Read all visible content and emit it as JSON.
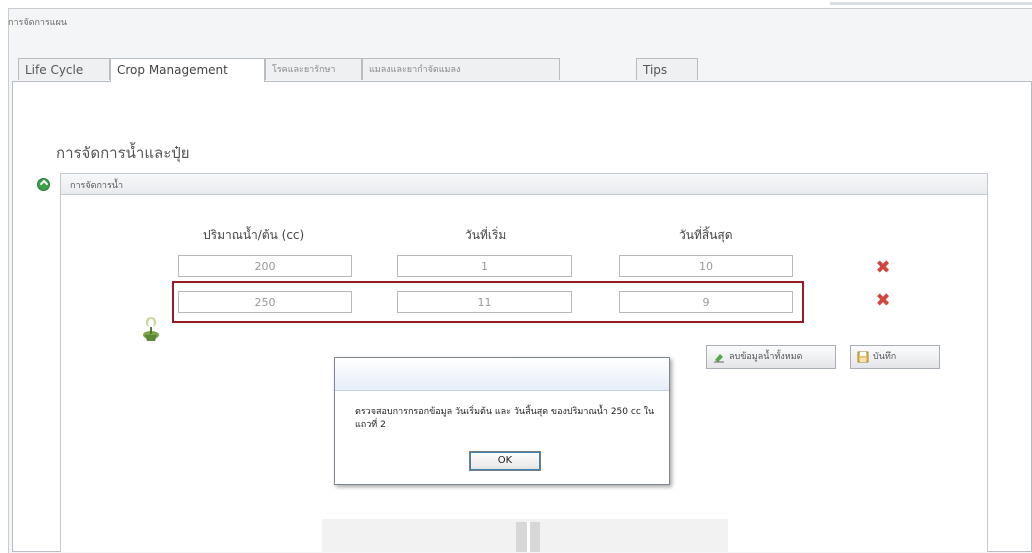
{
  "window": {
    "title": "การจัดการแผน"
  },
  "tabs": [
    {
      "label": "Life Cycle",
      "active": false
    },
    {
      "label": "Crop Management",
      "active": true
    },
    {
      "label": "โรคและยารักษา",
      "active": false
    },
    {
      "label": "แมลงและยากำจัดแมลง",
      "active": false
    },
    {
      "label": "Tips",
      "active": false
    }
  ],
  "section": {
    "title": "การจัดการน้ำและปุ๋ย"
  },
  "water_group": {
    "title": "การจัดการน้ำ",
    "columns": {
      "amount": "ปริมาณน้ำ/ต้น (cc)",
      "start": "วันที่เริ่ม",
      "end": "วันที่สิ้นสุด"
    },
    "rows": [
      {
        "amount": "200",
        "start": "1",
        "end": "10"
      },
      {
        "amount": "250",
        "start": "11",
        "end": "9"
      }
    ]
  },
  "buttons": {
    "reset_all": "ลบข้อมูลน้ำทั้งหมด",
    "save": "บันทึก"
  },
  "dialog": {
    "message": "ตรวจสอบการกรอกข้อมูล วันเริ่มต้น และ วันสิ้นสุด ของปริมาณน้ำ 250 cc ในแถวที่ 2",
    "ok_label": "OK"
  },
  "colors": {
    "highlight_border": "#9b1b22",
    "delete_icon": "#d2453f",
    "accent": "#3c7fb1"
  }
}
